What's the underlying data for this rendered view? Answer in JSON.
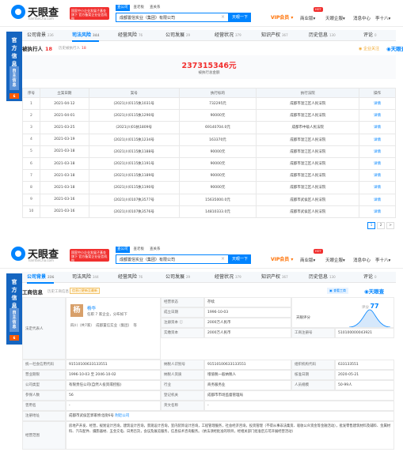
{
  "header": {
    "logo_name": "天眼查",
    "logo_sub": "TianYanCha.com",
    "promo": "国家中小企业发展子基金旗下 官方备案企业征信机构",
    "search_tabs": [
      "查公司",
      "查老板",
      "查关系"
    ],
    "search_value": "成都置信实业（集团）有限公司",
    "search_button": "天眼一下",
    "vip": "VIP会员",
    "hot": "HOT",
    "nav": [
      "商业版",
      "天眼企服",
      "消息中心",
      "李十八"
    ]
  },
  "gov": {
    "text": "官方信息",
    "lite": "自主信息",
    "badge": "6"
  },
  "screen1": {
    "tabs": [
      {
        "label": "公司背景",
        "count": "236"
      },
      {
        "label": "司法风险",
        "count": "344"
      },
      {
        "label": "经营风险",
        "count": "76"
      },
      {
        "label": "公司发展",
        "count": "29"
      },
      {
        "label": "经营状况",
        "count": "379"
      },
      {
        "label": "知识产权",
        "count": "367"
      },
      {
        "label": "历史信息",
        "count": "130"
      },
      {
        "label": "评论",
        "count": "0"
      }
    ],
    "section_title": "被执行人",
    "section_count": "18",
    "history_label": "历史被执行人",
    "history_count": "18",
    "fav": "企业关注",
    "watermark": "天眼查",
    "total_amount": "237315346元",
    "total_label": "被执行总金额",
    "columns": [
      "序号",
      "立案日期",
      "案号",
      "执行标的",
      "执行法院",
      "操作"
    ],
    "rows": [
      {
        "no": "1",
        "date": "2021-04-12",
        "case": "(2021)川0115执1031号",
        "amount": "732295元",
        "court": "成都市温江区人民法院",
        "op": "详情"
      },
      {
        "no": "2",
        "date": "2021-04-01",
        "case": "(2021)川0115执1290号",
        "amount": "90000元",
        "court": "成都市温江区人民法院",
        "op": "详情"
      },
      {
        "no": "3",
        "date": "2021-03-25",
        "case": "(2021)川01执1809号",
        "amount": "69140704.0元",
        "court": "成都市中级人民法院",
        "op": "详情"
      },
      {
        "no": "4",
        "date": "2021-03-19",
        "case": "(2021)川0115执1234号",
        "amount": "163370元",
        "court": "成都市温江区人民法院",
        "op": "详情"
      },
      {
        "no": "5",
        "date": "2021-03-18",
        "case": "(2021)川0115执1188号",
        "amount": "90000元",
        "court": "成都市温江区人民法院",
        "op": "详情"
      },
      {
        "no": "6",
        "date": "2021-03-18",
        "case": "(2021)川0115执1191号",
        "amount": "90000元",
        "court": "成都市温江区人民法院",
        "op": "详情"
      },
      {
        "no": "7",
        "date": "2021-03-18",
        "case": "(2021)川0115执1189号",
        "amount": "90000元",
        "court": "成都市温江区人民法院",
        "op": "详情"
      },
      {
        "no": "8",
        "date": "2021-03-18",
        "case": "(2021)川0115执1190号",
        "amount": "90000元",
        "court": "成都市温江区人民法院",
        "op": "详情"
      },
      {
        "no": "9",
        "date": "2021-03-16",
        "case": "(2021)川0107执3577号",
        "amount": "15635000.0元",
        "court": "成都市武侯区人民法院",
        "op": "详情"
      },
      {
        "no": "10",
        "date": "2021-03-16",
        "case": "(2021)川0107执3576号",
        "amount": "14810333.0元",
        "court": "成都市武侯区人民法院",
        "op": "详情"
      }
    ],
    "pages": [
      "1",
      "2",
      ">"
    ]
  },
  "screen2": {
    "tabs": [
      {
        "label": "公司背景",
        "count": "236"
      },
      {
        "label": "司法风险",
        "count": "344"
      },
      {
        "label": "经营风险",
        "count": "76"
      },
      {
        "label": "公司发展",
        "count": "29"
      },
      {
        "label": "经营状况",
        "count": "379"
      },
      {
        "label": "知识产权",
        "count": "367"
      },
      {
        "label": "历史信息",
        "count": "130"
      },
      {
        "label": "评论",
        "count": "0"
      }
    ],
    "section_title": "工商信息",
    "history_label": "历史工商信息",
    "history_count": "3",
    "tag": "信息已更新至最新",
    "action": "查看工商",
    "watermark": "天眼查",
    "lp_label": "法定代表人",
    "lp_avatar": "杨",
    "lp_name": "杨华",
    "lp_sub1": "任职 7 家企业，分布如下",
    "lp_sub2": "四川（共7家）　成都置信实业（集团）　等",
    "status_label": "经营状态",
    "status": "存续",
    "est_label": "成立日期",
    "est": "1996-10-03",
    "reg_cap_label": "注册资本",
    "reg_cap": "2000万人民币",
    "paid_cap_label": "实缴资本",
    "paid_cap": "2000万人民币",
    "score_label": "评分",
    "score": "77",
    "tyc_label": "天眼评分",
    "reg_no_label": "工商注册号",
    "reg_no": "510100000043921",
    "credit_label": "统一社会信用代码",
    "credit": "91510100633133551",
    "tax_label": "纳税人识别号",
    "tax": "91510100633133551",
    "org_label": "组织机构代码",
    "org": "633133551",
    "term_label": "营业期限",
    "term": "1996-10-03 至 2046-10-02",
    "taxq_label": "纳税人资质",
    "taxq": "增值税一般纳税人",
    "appr_label": "核准日期",
    "appr": "2020-05-21",
    "type_label": "公司类型",
    "type": "有限责任公司(自然人投资或控股)",
    "ind_label": "行业",
    "ind": "商务服务业",
    "staff_label": "人员规模",
    "staff": "50-99人",
    "ins_label": "参保人数",
    "ins": "56",
    "auth_label": "登记机关",
    "auth": "成都市市场监督管理局",
    "prev_label": "曾用名",
    "prev": "-",
    "en_label": "英文名称",
    "en": "-",
    "addr_label": "注册地址",
    "addr": "成都市武侯区郭家桥北街6号",
    "addr_link": "附近公司",
    "scope_label": "经营范围",
    "scope": "房地产开发、经营，规划设计咨询，建筑设计咨询，景观设计咨询，室内装饰设计咨询，工程管理服务，社会经济咨询，投资管理（不得从事非法集资、吸收公众资金等金融活动），批发零售建筑材料及辅料、金属材料、汽车配件、摄影器材、五金交电、日用百货，会议及展览服务，信息技术咨询服务。（依法须经批准的项目，经相关部门批准后方可开展经营活动）"
  }
}
